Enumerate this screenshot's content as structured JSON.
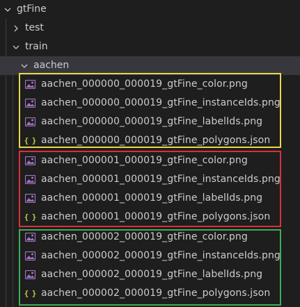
{
  "explorer": {
    "root": {
      "label": "gtFine",
      "expanded": true
    },
    "test": {
      "label": "test",
      "expanded": false
    },
    "train": {
      "label": "train",
      "expanded": true
    },
    "aachen": {
      "label": "aachen",
      "expanded": true
    },
    "files": [
      {
        "name": "aachen_000000_000019_gtFine_color.png",
        "icon": "image-file-icon"
      },
      {
        "name": "aachen_000000_000019_gtFine_instanceIds.png",
        "icon": "image-file-icon"
      },
      {
        "name": "aachen_000000_000019_gtFine_labelIds.png",
        "icon": "image-file-icon"
      },
      {
        "name": "aachen_000000_000019_gtFine_polygons.json",
        "icon": "json-file-icon"
      },
      {
        "name": "aachen_000001_000019_gtFine_color.png",
        "icon": "image-file-icon"
      },
      {
        "name": "aachen_000001_000019_gtFine_instanceIds.png",
        "icon": "image-file-icon"
      },
      {
        "name": "aachen_000001_000019_gtFine_labelIds.png",
        "icon": "image-file-icon"
      },
      {
        "name": "aachen_000001_000019_gtFine_polygons.json",
        "icon": "json-file-icon"
      },
      {
        "name": "aachen_000002_000019_gtFine_color.png",
        "icon": "image-file-icon"
      },
      {
        "name": "aachen_000002_000019_gtFine_instanceIds.png",
        "icon": "image-file-icon"
      },
      {
        "name": "aachen_000002_000019_gtFine_labelIds.png",
        "icon": "image-file-icon"
      },
      {
        "name": "aachen_000002_000019_gtFine_polygons.json",
        "icon": "json-file-icon"
      }
    ],
    "json_icon_glyph": "{ }"
  },
  "highlight_colors": {
    "group_000000": "#e8d84a",
    "group_000001": "#d9313b",
    "group_000002": "#3fae54"
  },
  "colors": {
    "background": "#1e1e1e",
    "selected_row": "#37373d",
    "text": "#cccccc",
    "image_icon": "#a074c4",
    "json_icon": "#cbcb41"
  }
}
